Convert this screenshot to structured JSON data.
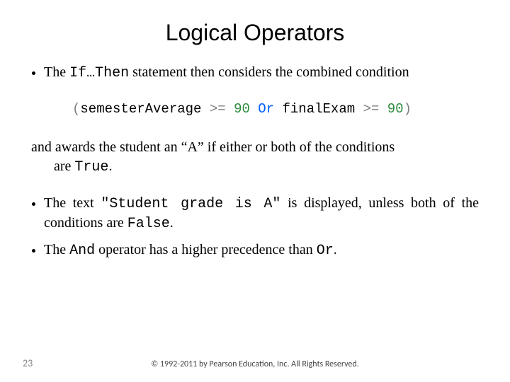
{
  "title": "Logical Operators",
  "bullet1": {
    "pre": "The ",
    "code": "If…Then",
    "post": " statement then considers the combined condition"
  },
  "code": {
    "lparen": "(",
    "id1": "semesterAverage ",
    "op1": ">= ",
    "num1": "90 ",
    "kw": "Or ",
    "id2": "finalExam ",
    "op2": ">= ",
    "num2": "90",
    "rparen": ")"
  },
  "para": {
    "line1": "and awards the student an “A” if either or both of the conditions",
    "line2_pre": "are ",
    "line2_code": "True",
    "line2_post": "."
  },
  "bullet2": {
    "pre": "The text ",
    "code": "\"Student grade is A\"",
    "post": " is displayed, unless both of the conditions are ",
    "code2": "False",
    "post2": "."
  },
  "bullet3": {
    "pre": "The ",
    "code": "And",
    "mid": " operator has a higher precedence than ",
    "code2": "Or",
    "post": "."
  },
  "page_number": "23",
  "copyright": "© 1992-2011 by Pearson Education, Inc. All Rights Reserved."
}
